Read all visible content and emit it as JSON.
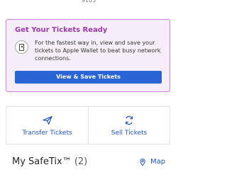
{
  "header": {
    "partial_text": "9105"
  },
  "ticket_notice": {
    "title": "Get Your Tickets Ready",
    "message": "For the fastest way in, view and save your tickets to Apple Wallet to beat busy network connections.",
    "button_label": "View & Save Tickets",
    "icon": "phone-icon"
  },
  "actions": [
    {
      "label": "Transfer Tickets",
      "icon": "send-icon"
    },
    {
      "label": "Sell Tickets",
      "icon": "refresh-icon"
    }
  ],
  "safetix": {
    "title": "My SafeTix™",
    "count": "(2)",
    "map_label": "Map",
    "map_icon": "location-pin-icon"
  },
  "colors": {
    "notice_background": "#f5eef8",
    "notice_border": "#c882d4",
    "notice_title": "#9b3aa8",
    "button_blue": "#2a63d4",
    "link_blue": "#1f56c7"
  }
}
